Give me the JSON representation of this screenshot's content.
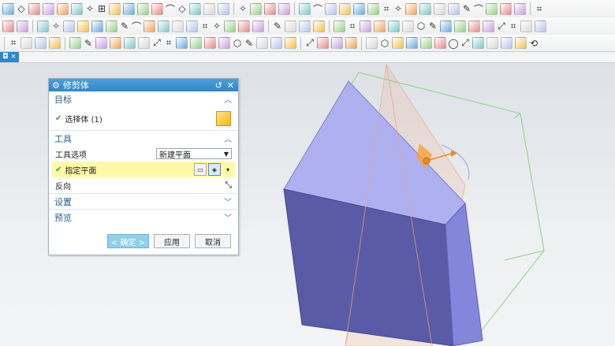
{
  "dialog": {
    "title": "修剪体",
    "sections": {
      "target": {
        "label": "目标",
        "item_label": "选择体 (1)"
      },
      "tool": {
        "label": "工具",
        "option_label": "工具选项",
        "option_value": "新建平面",
        "plane_label": "指定平面",
        "reverse_label": "反向"
      },
      "settings": {
        "label": "设置"
      },
      "preview": {
        "label": "预览"
      }
    },
    "buttons": {
      "ok": "< 确定 >",
      "apply": "应用",
      "cancel": "取消"
    }
  },
  "icons": {
    "title_gear": "gear-icon",
    "reset": "reset-icon",
    "close": "close-icon"
  },
  "colors": {
    "dialog_title_bg": "#2f86c9",
    "highlight_row": "#fff9a8",
    "solid_top": "#aeb0f0",
    "solid_front": "#595ba6",
    "solid_side": "#8486dc",
    "plane_color": "#f0a27a"
  }
}
